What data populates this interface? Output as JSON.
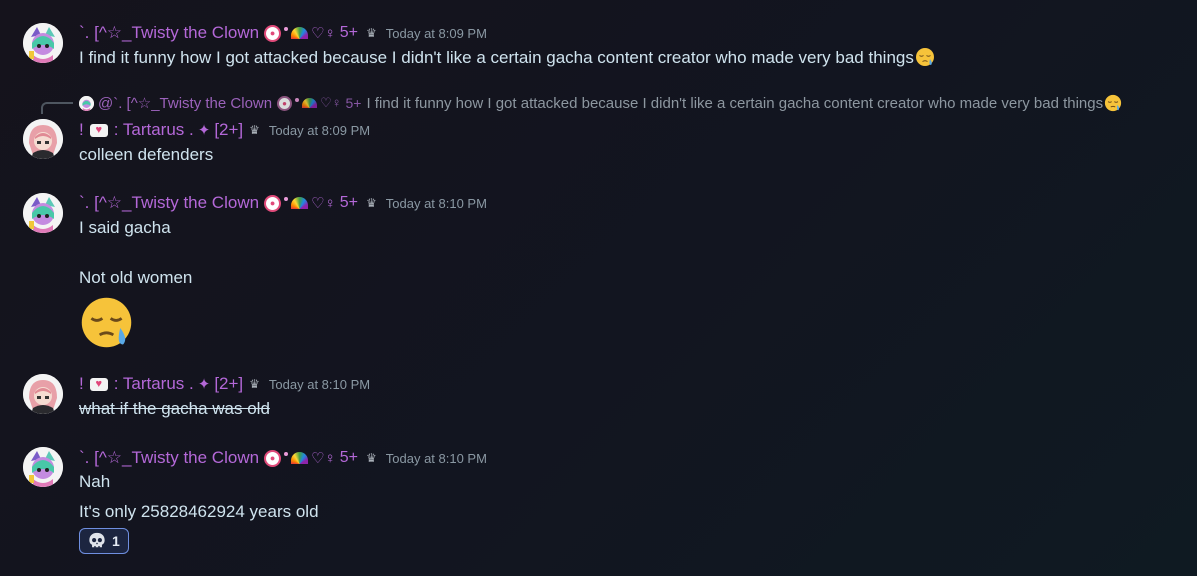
{
  "messages": [
    {
      "author": "`. [^☆_Twisty the Clown",
      "badge_count": "5+",
      "badge_gender": "♡♀",
      "timestamp": "Today at 8:09 PM",
      "text": "I find it funny how I got attacked because I didn't like a certain gacha content creator who made very bad things",
      "emoji": "sleepy-face-icon"
    },
    {
      "reply_to": {
        "author": "@`. [^☆_Twisty the Clown",
        "badge_count": "5+",
        "badge_gender": "♡♀",
        "text": "I find it funny how I got attacked because I didn't like a certain gacha content creator who made very bad things"
      },
      "author_prefix": "!",
      "author": ": Tartarus .",
      "sparkle": "✦",
      "author_suffix": "[2+]",
      "timestamp": "Today at 8:09 PM",
      "text": "colleen defenders"
    },
    {
      "author": "`. [^☆_Twisty the Clown",
      "badge_count": "5+",
      "badge_gender": "♡♀",
      "timestamp": "Today at 8:10 PM",
      "line1": "I said gacha",
      "line2": "Not old women",
      "big_emoji": "sleepy-face-icon"
    },
    {
      "author_prefix": "!",
      "author": ": Tartarus .",
      "sparkle": "✦",
      "author_suffix": "[2+]",
      "timestamp": "Today at 8:10 PM",
      "text": "what if the gacha was old",
      "strikethrough": true
    },
    {
      "author": "`. [^☆_Twisty the Clown",
      "badge_count": "5+",
      "badge_gender": "♡♀",
      "timestamp": "Today at 8:10 PM",
      "line1": "Nah",
      "line2": "It's only 25828462924 years old",
      "reaction": {
        "icon": "skull-icon",
        "count": "1"
      }
    }
  ],
  "colors": {
    "username": "#b468d8",
    "text": "#cfe3ee",
    "timestamp": "#8a98a3",
    "reaction_border": "#6f8fe0"
  }
}
